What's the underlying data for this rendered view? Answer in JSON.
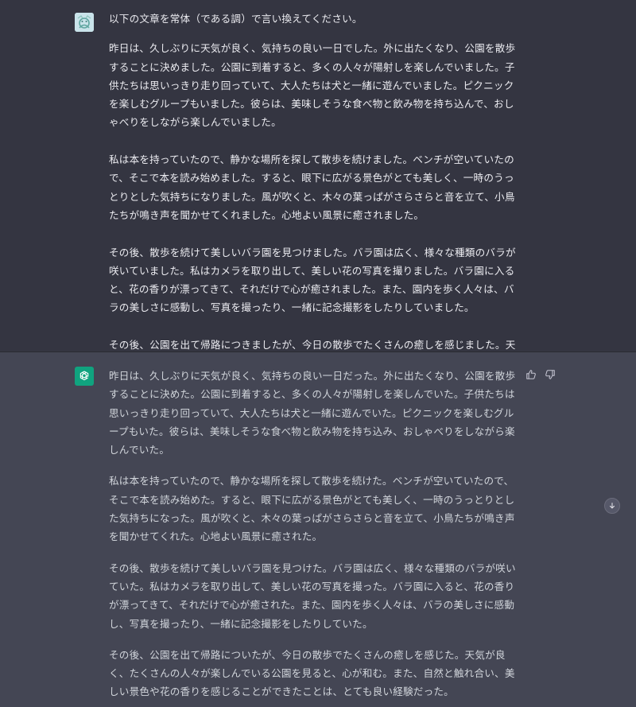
{
  "conversation": {
    "user_message": {
      "paragraphs": [
        "以下の文章を常体（である調）で言い換えてください。",
        "昨日は、久しぶりに天気が良く、気持ちの良い一日でした。外に出たくなり、公園を散歩することに決めました。公園に到着すると、多くの人々が陽射しを楽しんでいました。子供たちは思いっきり走り回っていて、大人たちは犬と一緒に遊んでいました。ピクニックを楽しむグループもいました。彼らは、美味しそうな食べ物と飲み物を持ち込んで、おしゃべりをしながら楽しんでいました。",
        "私は本を持っていたので、静かな場所を探して散歩を続けました。ベンチが空いていたので、そこで本を読み始めました。すると、眼下に広がる景色がとても美しく、一時のうっとりとした気持ちになりました。風が吹くと、木々の葉っぱがさらさらと音を立て、小鳥たちが鳴き声を聞かせてくれました。心地よい風景に癒されました。",
        "その後、散歩を続けて美しいバラ園を見つけました。バラ園は広く、様々な種類のバラが咲いていました。私はカメラを取り出して、美しい花の写真を撮りました。バラ園に入ると、花の香りが漂ってきて、それだけで心が癒されました。また、園内を歩く人々は、バラの美しさに感動し、写真を撮ったり、一緒に記念撮影をしたりしていました。",
        "その後、公園を出て帰路につきましたが、今日の散歩でたくさんの癒しを感じました。天気が良く、たくさんの人々が楽しんでいる公園を見ると、心が和みます。また、自然と触れ合い、美しい景色や花の香りを感じることができたことは、とても良い経験でした。"
      ]
    },
    "assistant_message": {
      "paragraphs": [
        "昨日は、久しぶりに天気が良く、気持ちの良い一日だった。外に出たくなり、公園を散歩することに決めた。公園に到着すると、多くの人々が陽射しを楽しんでいた。子供たちは思いっきり走り回っていて、大人たちは犬と一緒に遊んでいた。ピクニックを楽しむグループもいた。彼らは、美味しそうな食べ物と飲み物を持ち込み、おしゃべりをしながら楽しんでいた。",
        "私は本を持っていたので、静かな場所を探して散歩を続けた。ベンチが空いていたので、そこで本を読み始めた。すると、眼下に広がる景色がとても美しく、一時のうっとりとした気持ちになった。風が吹くと、木々の葉っぱがさらさらと音を立て、小鳥たちが鳴き声を聞かせてくれた。心地よい風景に癒された。",
        "その後、散歩を続けて美しいバラ園を見つけた。バラ園は広く、様々な種類のバラが咲いていた。私はカメラを取り出して、美しい花の写真を撮った。バラ園に入ると、花の香りが漂ってきて、それだけで心が癒された。また、園内を歩く人々は、バラの美しさに感動し、写真を撮ったり、一緒に記念撮影をしたりしていた。",
        "その後、公園を出て帰路についたが、今日の散歩でたくさんの癒しを感じた。天気が良く、たくさんの人々が楽しんでいる公園を見ると、心が和む。また、自然と触れ合い、美しい景色や花の香りを感じることができたことは、とても良い経験だった。"
      ]
    }
  },
  "icons": {
    "user_avatar": "user-avatar-icon",
    "assistant_avatar": "openai-logo-icon",
    "thumbs_up": "thumbs-up-icon",
    "thumbs_down": "thumbs-down-icon",
    "scroll_down": "arrow-down-icon"
  },
  "colors": {
    "user_bg": "#343541",
    "assistant_bg": "#444654",
    "assistant_avatar_bg": "#10a37f",
    "text": "#ececf1"
  }
}
